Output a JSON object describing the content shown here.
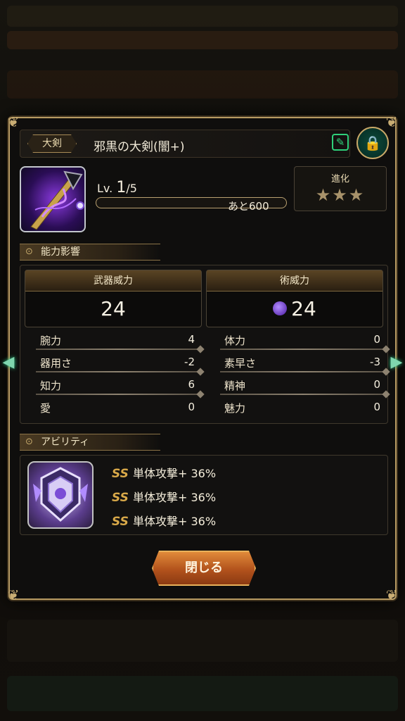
{
  "weapon": {
    "type_label": "大剣",
    "name": "邪黒の大剣(闇+)",
    "level_prefix": "Lv.",
    "level_current": "1",
    "level_max": "/5",
    "exp_remaining": "あと600",
    "exp_fill_fraction": 0.0,
    "evolution_label": "進化",
    "evolution_stars": "★★★"
  },
  "sections": {
    "ability_effect": "能力影響",
    "ability": "アビリティ"
  },
  "power": {
    "weapon_label": "武器威力",
    "weapon_value": "24",
    "magic_label": "術威力",
    "magic_value": "24"
  },
  "stats": {
    "left": [
      {
        "label": "腕力",
        "value": "4"
      },
      {
        "label": "器用さ",
        "value": "-2"
      },
      {
        "label": "知力",
        "value": "6"
      },
      {
        "label": "愛",
        "value": "0"
      }
    ],
    "right": [
      {
        "label": "体力",
        "value": "0"
      },
      {
        "label": "素早さ",
        "value": "-3"
      },
      {
        "label": "精神",
        "value": "0"
      },
      {
        "label": "魅力",
        "value": "0"
      }
    ]
  },
  "abilities": [
    {
      "rank": "SS",
      "text": "単体攻撃+ 36%"
    },
    {
      "rank": "SS",
      "text": "単体攻撃+ 36%"
    },
    {
      "rank": "SS",
      "text": "単体攻撃+ 36%"
    }
  ],
  "buttons": {
    "close": "閉じる"
  },
  "colors": {
    "frame_gold": "#b79a62",
    "lock_green": "#0d4a3b",
    "edit_green": "#2fd07a",
    "button_orange": "#e08a3a"
  }
}
